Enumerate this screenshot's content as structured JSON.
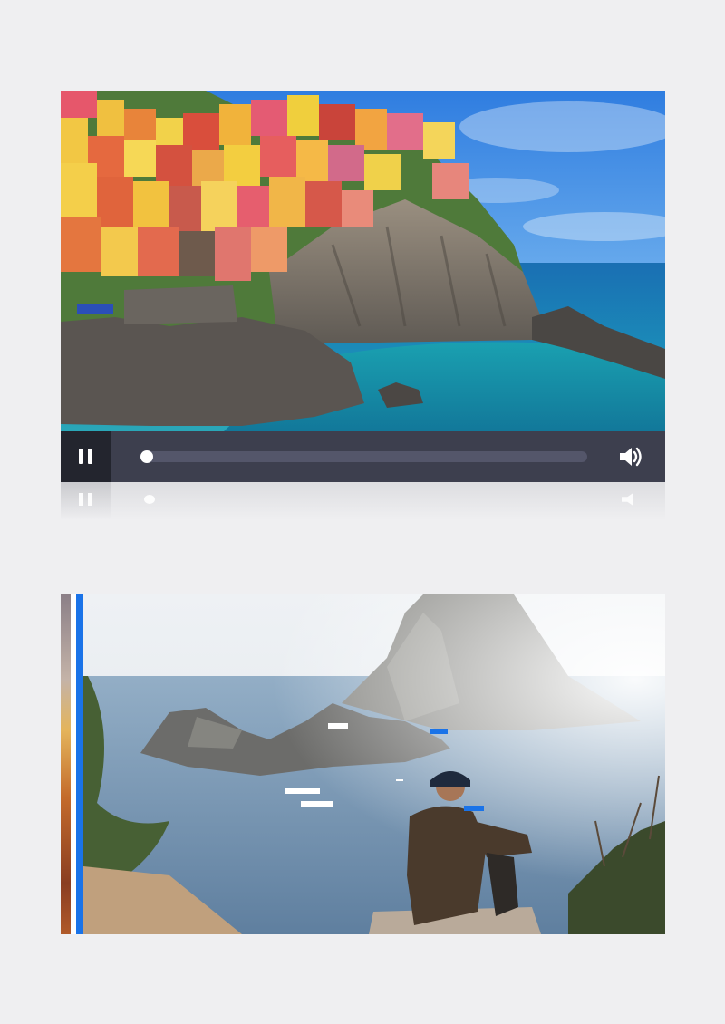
{
  "player": {
    "state": "playing",
    "progress": 0.0,
    "pause_icon": "pause-icon",
    "volume_icon": "volume-icon",
    "colors": {
      "control_bar": "#3d3f4e",
      "button_bg": "#23252e",
      "track": "#54566a",
      "knob": "#ffffff"
    }
  },
  "panel": {
    "accent": "#1a73e8"
  }
}
